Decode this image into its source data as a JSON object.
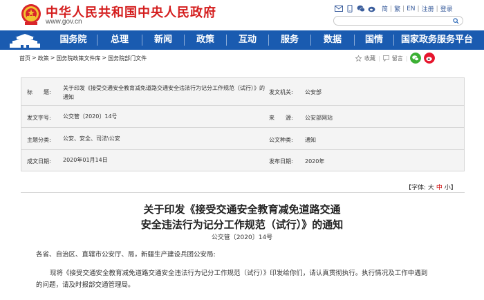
{
  "header": {
    "site_title": "中华人民共和国中央人民政府",
    "site_url": "www.gov.cn",
    "lang_links": [
      "简",
      "繁",
      "EN",
      "注册",
      "登录"
    ],
    "search_placeholder": ""
  },
  "nav": {
    "items": [
      "国务院",
      "总理",
      "新闻",
      "政策",
      "互动",
      "服务",
      "数据",
      "国情",
      "国家政务服务平台"
    ]
  },
  "breadcrumb": [
    "首页",
    "政策",
    "国务院政策文件库",
    "国务院部门文件"
  ],
  "share": {
    "collect": "收藏",
    "comment": "留言"
  },
  "meta": {
    "title_label": "标　　题:",
    "title_value": "关于印发《接受交通安全教育减免道路交通安全违法行为记分工作规范（试行）》的通知",
    "issuer_label": "发文机关:",
    "issuer_value": "公安部",
    "docno_label": "发文字号:",
    "docno_value": "公交管〔2020〕14号",
    "source_label": "来　　源:",
    "source_value": "公安部网站",
    "topic_label": "主题分类:",
    "topic_value": "公安、安全、司法\\公安",
    "type_label": "公文种类:",
    "type_value": "通知",
    "date_label": "成文日期:",
    "date_value": "2020年01月14日",
    "pubdate_label": "发布日期:",
    "pubdate_value": "2020年"
  },
  "fontsize": {
    "prefix": "【字体:",
    "big": "大",
    "mid": "中",
    "small": "小",
    "suffix": "】"
  },
  "doc": {
    "title_line1": "关于印发《接受交通安全教育减免道路交通",
    "title_line2": "安全违法行为记分工作规范（试行）》的通知",
    "number": "公交管〔2020〕14号",
    "salutation": "各省、自治区、直辖市公安厅、局，新疆生产建设兵团公安局:",
    "body_line1": "现将《接受交通安全教育减免道路交通安全违法行为记分工作规范（试行）》印发给你们，请认真贯彻执行。执行情况及工作中遇到",
    "body_line2": "的问题，请及时报部交通管理局。"
  }
}
